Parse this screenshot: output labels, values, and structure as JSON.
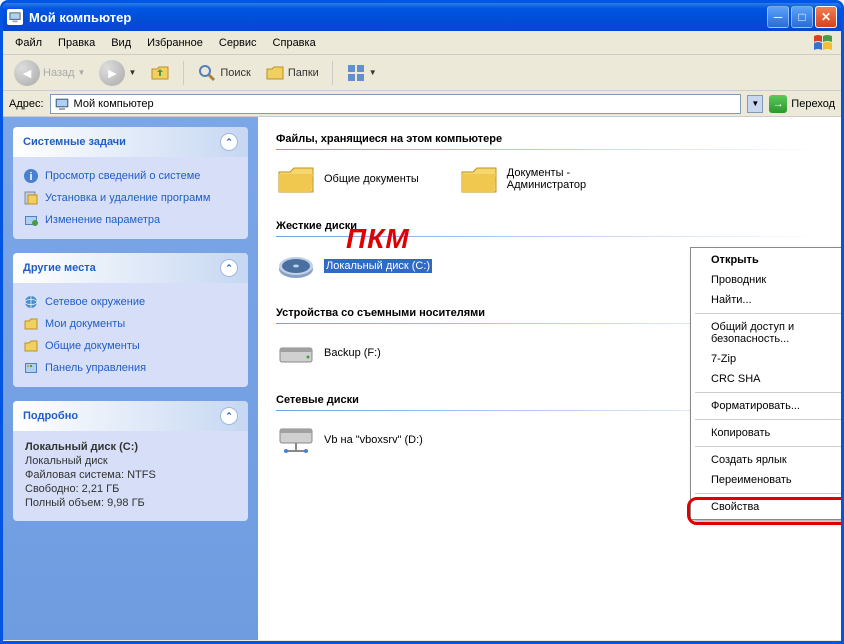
{
  "window": {
    "title": "Мой компьютер"
  },
  "menubar": [
    "Файл",
    "Правка",
    "Вид",
    "Избранное",
    "Сервис",
    "Справка"
  ],
  "toolbar": {
    "back": "Назад",
    "search": "Поиск",
    "folders": "Папки"
  },
  "addressbar": {
    "label": "Адрес:",
    "value": "Мой компьютер",
    "go": "Переход"
  },
  "sidebar": {
    "panels": [
      {
        "title": "Системные задачи",
        "items": [
          "Просмотр сведений о системе",
          "Установка и удаление программ",
          "Изменение параметра"
        ]
      },
      {
        "title": "Другие места",
        "items": [
          "Сетевое окружение",
          "Мои документы",
          "Общие документы",
          "Панель управления"
        ]
      },
      {
        "title": "Подробно",
        "details": {
          "name": "Локальный диск (C:)",
          "type": "Локальный диск",
          "filesystem": "Файловая система: NTFS",
          "free": "Свободно: 2,21 ГБ",
          "total": "Полный объем: 9,98 ГБ"
        }
      }
    ]
  },
  "main": {
    "sections": [
      {
        "header": "Файлы, хранящиеся на этом компьютере",
        "items": [
          "Общие документы",
          "Документы - Администратор"
        ]
      },
      {
        "header": "Жесткие диски",
        "items": [
          "Локальный диск (C:)"
        ]
      },
      {
        "header": "Устройства со съемными носителями",
        "items": [
          "Backup (F:)"
        ]
      },
      {
        "header": "Сетевые диски",
        "items": [
          "Vb на \"vboxsrv\" (D:)"
        ]
      }
    ]
  },
  "annotation": "ПКМ",
  "context_menu": [
    {
      "label": "Открыть",
      "bold": true
    },
    {
      "label": "Проводник"
    },
    {
      "label": "Найти..."
    },
    {
      "sep": true
    },
    {
      "label": "Общий доступ и безопасность..."
    },
    {
      "label": "7-Zip",
      "arrow": true
    },
    {
      "label": "CRC SHA",
      "arrow": true
    },
    {
      "sep": true
    },
    {
      "label": "Форматировать..."
    },
    {
      "sep": true
    },
    {
      "label": "Копировать"
    },
    {
      "sep": true
    },
    {
      "label": "Создать ярлык"
    },
    {
      "label": "Переименовать"
    },
    {
      "sep": true
    },
    {
      "label": "Свойства"
    }
  ]
}
